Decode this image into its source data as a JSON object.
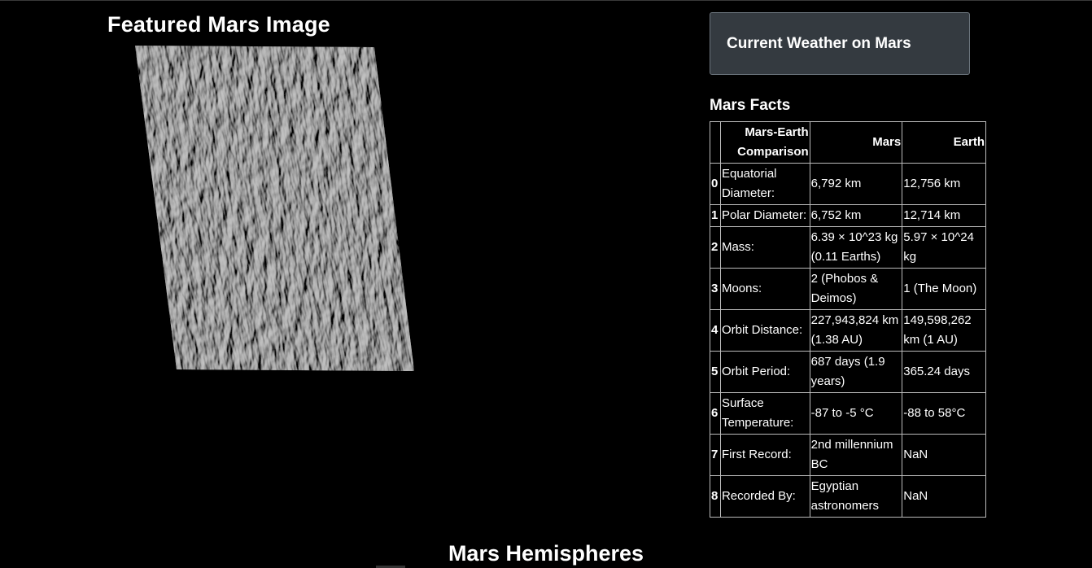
{
  "featured": {
    "title": "Featured Mars Image"
  },
  "weather": {
    "button_label": "Current Weather on Mars"
  },
  "facts": {
    "title": "Mars Facts",
    "headers": [
      "",
      "Mars-Earth Comparison",
      "Mars",
      "Earth"
    ],
    "rows": [
      {
        "index": "0",
        "label": "Equatorial Diameter:",
        "mars": "6,792 km",
        "earth": "12,756 km"
      },
      {
        "index": "1",
        "label": "Polar Diameter:",
        "mars": "6,752 km",
        "earth": "12,714 km"
      },
      {
        "index": "2",
        "label": "Mass:",
        "mars": "6.39 × 10^23 kg (0.11 Earths)",
        "earth": "5.97 × 10^24 kg"
      },
      {
        "index": "3",
        "label": "Moons:",
        "mars": "2 (Phobos & Deimos)",
        "earth": "1 (The Moon)"
      },
      {
        "index": "4",
        "label": "Orbit Distance:",
        "mars": "227,943,824 km (1.38 AU)",
        "earth": "149,598,262 km (1 AU)"
      },
      {
        "index": "5",
        "label": "Orbit Period:",
        "mars": "687 days (1.9 years)",
        "earth": "365.24 days"
      },
      {
        "index": "6",
        "label": "Surface Temperature:",
        "mars": "-87 to -5 °C",
        "earth": "-88 to 58°C"
      },
      {
        "index": "7",
        "label": "First Record:",
        "mars": "2nd millennium BC",
        "earth": "NaN"
      },
      {
        "index": "8",
        "label": "Recorded By:",
        "mars": "Egyptian astronomers",
        "earth": "NaN"
      }
    ]
  },
  "hemispheres": {
    "title": "Mars Hemispheres"
  }
}
